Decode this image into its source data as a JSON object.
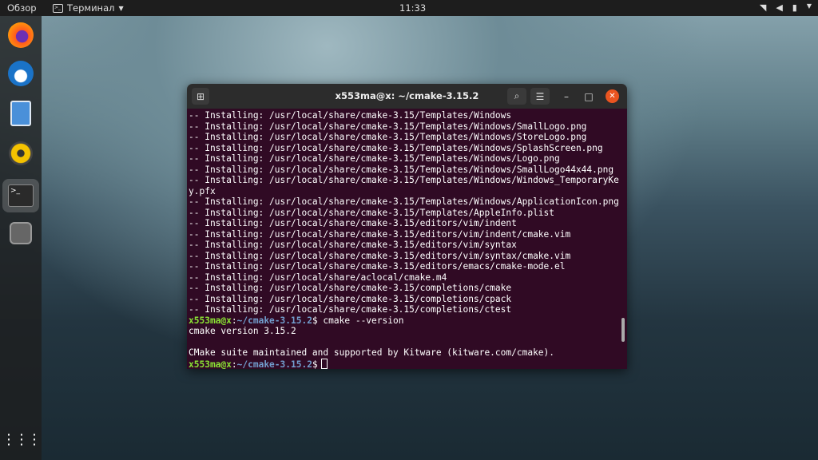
{
  "topbar": {
    "overview": "Обзор",
    "app": "Терминал",
    "clock": "11:33"
  },
  "window": {
    "title": "x553ma@x: ~/cmake-3.15.2"
  },
  "terminal": {
    "install_lines": [
      "-- Installing: /usr/local/share/cmake-3.15/Templates/Windows",
      "-- Installing: /usr/local/share/cmake-3.15/Templates/Windows/SmallLogo.png",
      "-- Installing: /usr/local/share/cmake-3.15/Templates/Windows/StoreLogo.png",
      "-- Installing: /usr/local/share/cmake-3.15/Templates/Windows/SplashScreen.png",
      "-- Installing: /usr/local/share/cmake-3.15/Templates/Windows/Logo.png",
      "-- Installing: /usr/local/share/cmake-3.15/Templates/Windows/SmallLogo44x44.png",
      "-- Installing: /usr/local/share/cmake-3.15/Templates/Windows/Windows_TemporaryKe",
      "y.pfx",
      "-- Installing: /usr/local/share/cmake-3.15/Templates/Windows/ApplicationIcon.png",
      "-- Installing: /usr/local/share/cmake-3.15/Templates/AppleInfo.plist",
      "-- Installing: /usr/local/share/cmake-3.15/editors/vim/indent",
      "-- Installing: /usr/local/share/cmake-3.15/editors/vim/indent/cmake.vim",
      "-- Installing: /usr/local/share/cmake-3.15/editors/vim/syntax",
      "-- Installing: /usr/local/share/cmake-3.15/editors/vim/syntax/cmake.vim",
      "-- Installing: /usr/local/share/cmake-3.15/editors/emacs/cmake-mode.el",
      "-- Installing: /usr/local/share/aclocal/cmake.m4",
      "-- Installing: /usr/local/share/cmake-3.15/completions/cmake",
      "-- Installing: /usr/local/share/cmake-3.15/completions/cpack",
      "-- Installing: /usr/local/share/cmake-3.15/completions/ctest"
    ],
    "prompt_user": "x553ma@x",
    "prompt_path": "~/cmake-3.15.2",
    "command": "cmake --version",
    "output1": "cmake version 3.15.2",
    "output2": "CMake suite maintained and supported by Kitware (kitware.com/cmake)."
  }
}
